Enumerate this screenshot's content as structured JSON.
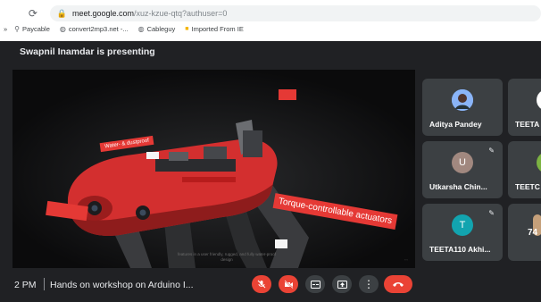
{
  "browser": {
    "url_host": "meet.google.com",
    "url_path": "/xuz-kzue-qtq?authuser=0",
    "bookmarks": [
      {
        "label": "Paycable",
        "icon": "pin-icon"
      },
      {
        "label": "convert2mp3.net -...",
        "icon": "globe-icon"
      },
      {
        "label": "Cableguy",
        "icon": "globe-icon"
      },
      {
        "label": "Imported From IE",
        "icon": "folder-icon"
      }
    ]
  },
  "meet": {
    "presenting_label": "Swapnil Inamdar is presenting",
    "slide": {
      "tag_small": "Water- & dustproof",
      "tag_big": "Torque-controllable actuators",
      "caption": "features in a user friendly, rugged, and fully water-proof design"
    },
    "participants": [
      {
        "name": "Aditya Pandey",
        "avatar": "photo",
        "avatar_color": "#8ab4f8"
      },
      {
        "name": "TEETA",
        "avatar": "",
        "avatar_color": "#ffffff"
      },
      {
        "name": "Utkarsha Chin...",
        "avatar": "U",
        "avatar_color": "#a1887f"
      },
      {
        "name": "TEETC",
        "avatar": "",
        "avatar_color": "#7cb342"
      },
      {
        "name": "TEETA110 Akhi...",
        "avatar": "T",
        "avatar_color": "#12a4af"
      },
      {
        "name": "74",
        "avatar": "",
        "avatar_color": "#c5a07a"
      }
    ],
    "bottom": {
      "time": "2 PM",
      "title": "Hands on workshop on Arduino I...",
      "controls": [
        "mic-off-icon",
        "camera-off-icon",
        "captions-icon",
        "present-icon",
        "more-icon",
        "end-call-icon"
      ]
    }
  },
  "colors": {
    "meet_bg": "#202124",
    "tile_bg": "#3c4043",
    "danger": "#ea4335",
    "slide_red": "#e53935"
  }
}
